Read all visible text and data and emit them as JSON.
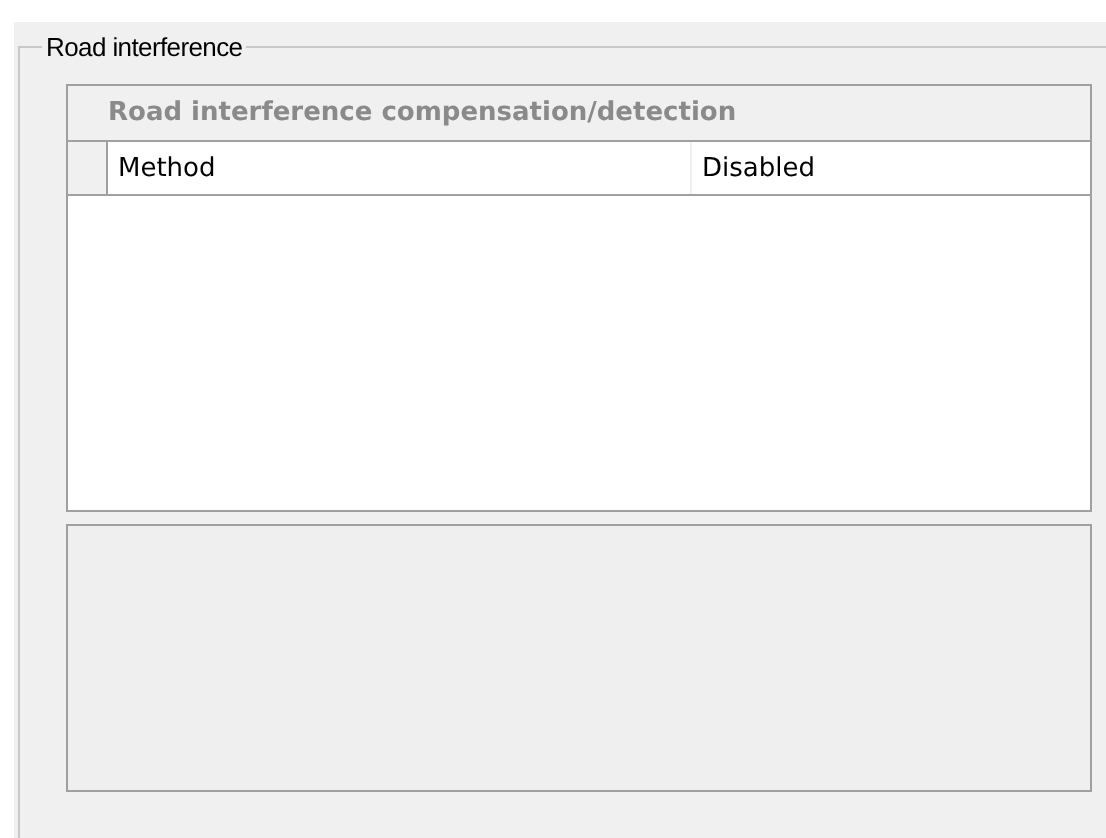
{
  "group": {
    "title": "Road interference"
  },
  "property_grid": {
    "categories": [
      {
        "name": "Road interference compensation/detection",
        "properties": [
          {
            "name": "Method",
            "value": "Disabled"
          }
        ]
      }
    ]
  }
}
